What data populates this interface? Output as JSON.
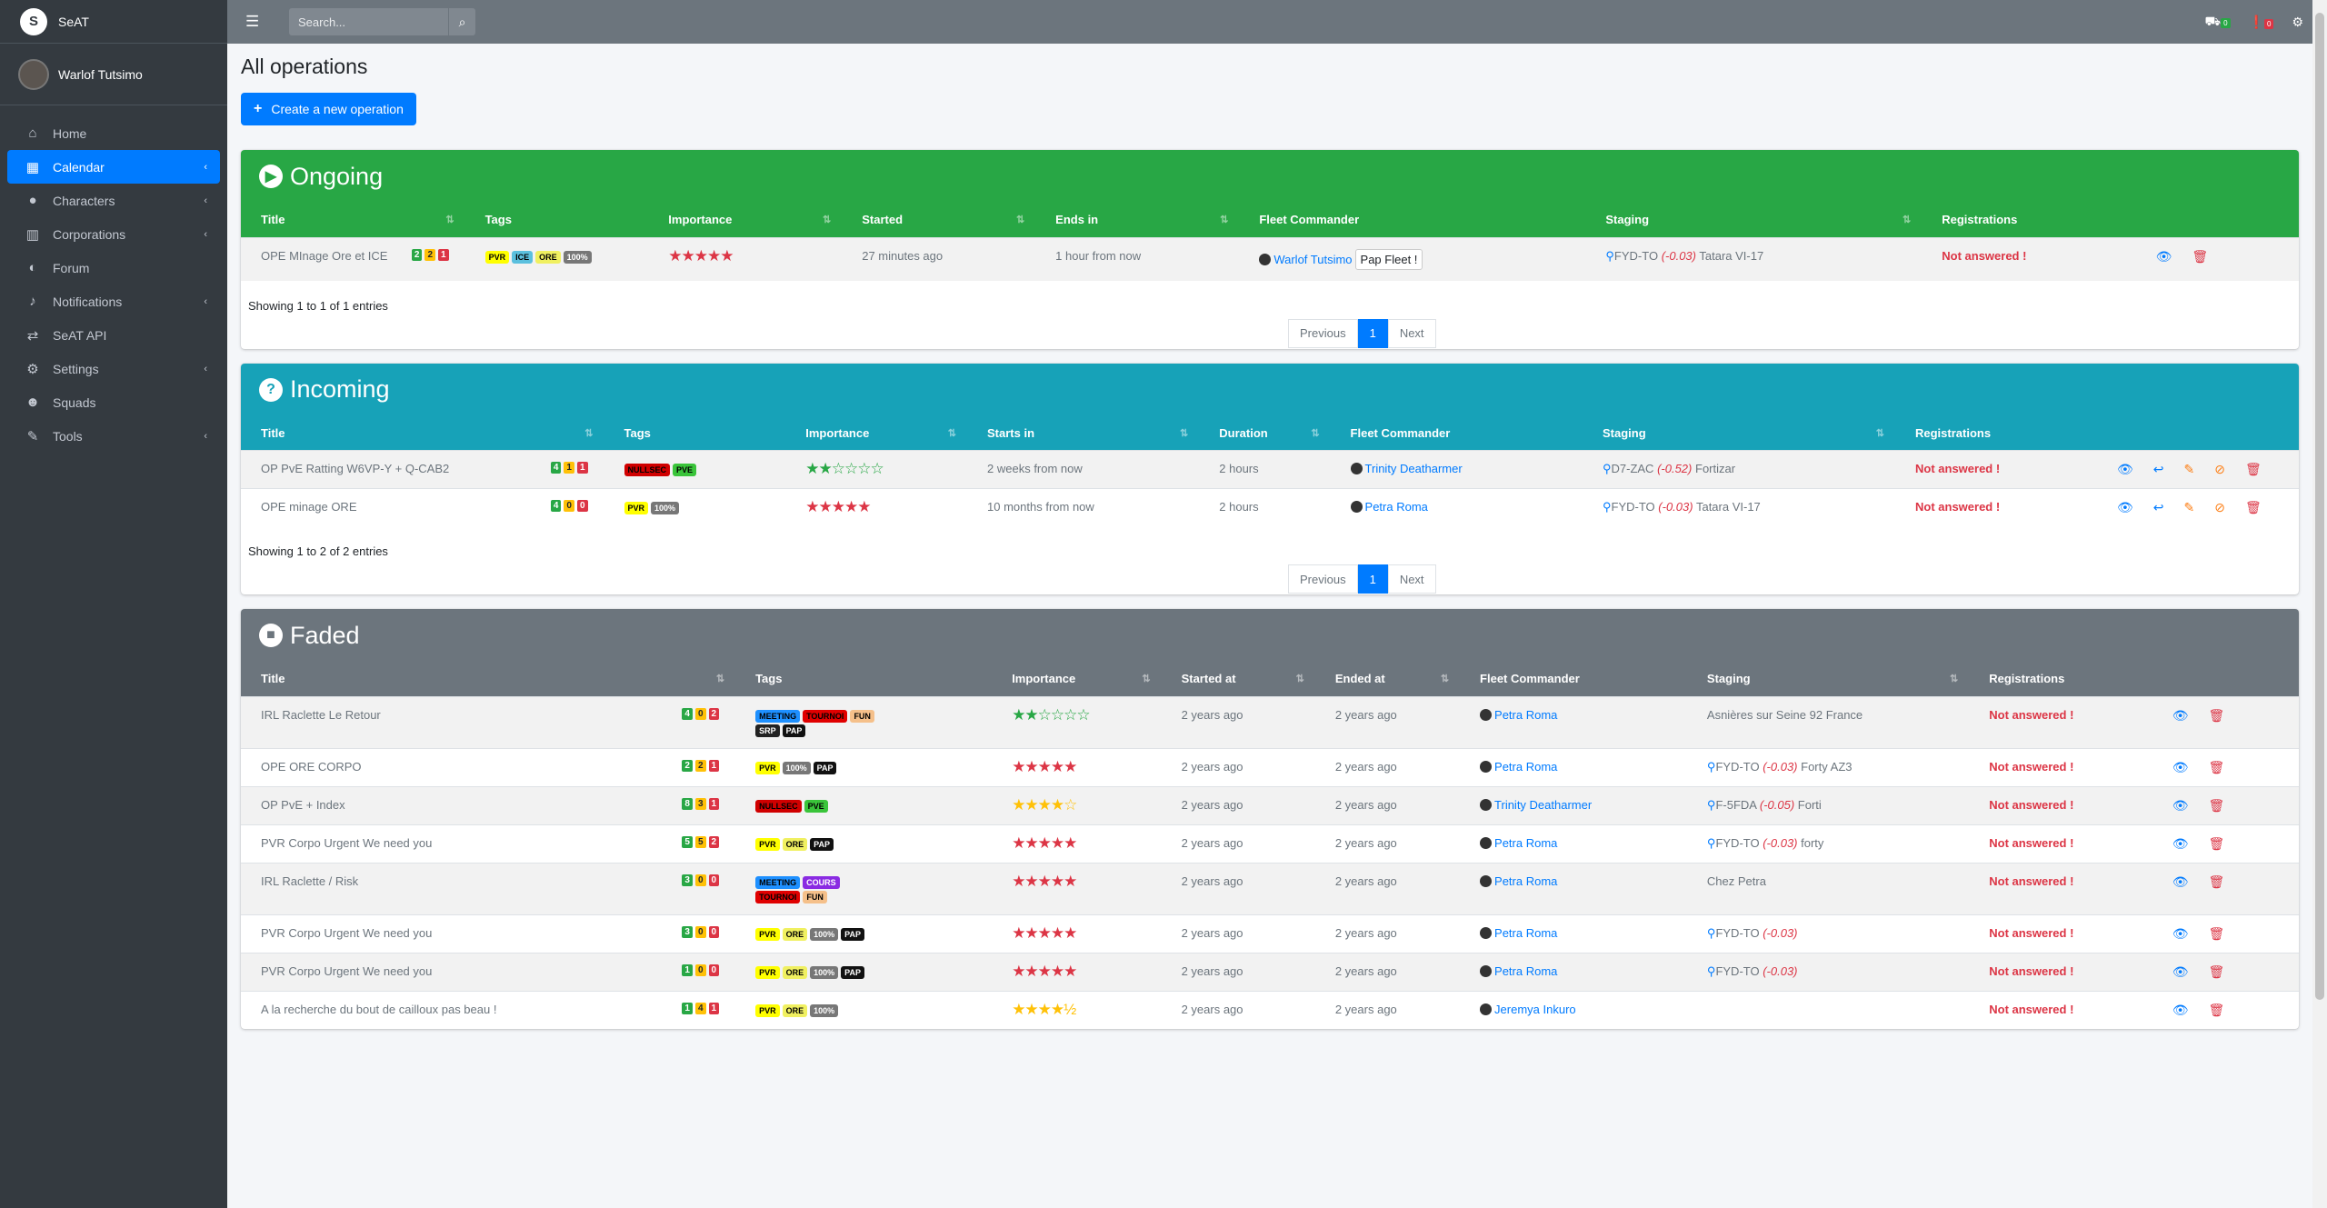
{
  "app": {
    "brand": "SeAT",
    "logo": "S",
    "user": "Warlof Tutsimo"
  },
  "sidebar": {
    "items": [
      {
        "label": "Home",
        "icon": "⌂",
        "chev": ""
      },
      {
        "label": "Calendar",
        "icon": "▦",
        "chev": "‹"
      },
      {
        "label": "Characters",
        "icon": "●",
        "chev": "‹"
      },
      {
        "label": "Corporations",
        "icon": "▥",
        "chev": "‹"
      },
      {
        "label": "Forum",
        "icon": "◐",
        "chev": ""
      },
      {
        "label": "Notifications",
        "icon": "♪",
        "chev": "‹"
      },
      {
        "label": "SeAT API",
        "icon": "⇄",
        "chev": ""
      },
      {
        "label": "Settings",
        "icon": "⚙",
        "chev": "‹"
      },
      {
        "label": "Squads",
        "icon": "☻",
        "chev": ""
      },
      {
        "label": "Tools",
        "icon": "✎",
        "chev": "‹"
      }
    ]
  },
  "topbar": {
    "search_placeholder": "Search...",
    "queue_count": "0",
    "error_count": "0"
  },
  "page": {
    "title": "All operations",
    "create_label": "Create a new operation",
    "showing_1": "Showing 1 to 1 of 1 entries",
    "showing_2": "Showing 1 to 2 of 2 entries",
    "pager": {
      "prev": "Previous",
      "page": "1",
      "next": "Next"
    }
  },
  "ongoing": {
    "title": "Ongoing",
    "headers": [
      "Title",
      "Tags",
      "Importance",
      "Started",
      "Ends in",
      "Fleet Commander",
      "Staging",
      "Registrations"
    ],
    "rows": [
      {
        "title": "OPE MInage Ore et ICE",
        "counts": [
          "2",
          "2",
          "1"
        ],
        "tags": [
          "PVR",
          "ICE",
          "ORE",
          "100%"
        ],
        "stars": "★★★★★",
        "time1": "27 minutes ago",
        "time2": "1 hour from now",
        "fc": "Warlof Tutsimo",
        "pap": "Pap Fleet !",
        "system": "FYD-TO",
        "sec": "(-0.03)",
        "station": "Tatara VI-17",
        "reg": "Not answered !"
      }
    ]
  },
  "incoming": {
    "title": "Incoming",
    "headers": [
      "Title",
      "Tags",
      "Importance",
      "Starts in",
      "Duration",
      "Fleet Commander",
      "Staging",
      "Registrations"
    ],
    "rows": [
      {
        "title": "OP PvE Ratting W6VP-Y + Q-CAB2",
        "counts": [
          "4",
          "1",
          "1"
        ],
        "tags": [
          "NULLSEC",
          "PVE"
        ],
        "stars": "★★☆☆☆☆",
        "time1": "2 weeks from now",
        "time2": "2 hours",
        "fc": "Trinity Deatharmer",
        "system": "D7-ZAC",
        "sec": "(-0.52)",
        "station": "Fortizar",
        "reg": "Not answered !"
      },
      {
        "title": "OPE minage ORE",
        "counts": [
          "4",
          "0",
          "0"
        ],
        "tags": [
          "PVR",
          "100%"
        ],
        "stars": "★★★★★",
        "time1": "10 months from now",
        "time2": "2 hours",
        "fc": "Petra Roma",
        "system": "FYD-TO",
        "sec": "(-0.03)",
        "station": "Tatara VI-17",
        "reg": "Not answered !"
      }
    ]
  },
  "faded": {
    "title": "Faded",
    "headers": [
      "Title",
      "Tags",
      "Importance",
      "Started at",
      "Ended at",
      "Fleet Commander",
      "Staging",
      "Registrations"
    ],
    "rows": [
      {
        "title": "IRL Raclette Le Retour",
        "counts": [
          "4",
          "0",
          "2"
        ],
        "tags": [
          "MEETING",
          "TOURNOI",
          "FUN",
          "SRP",
          "PAP"
        ],
        "stars": "★★☆☆☆☆",
        "time1": "2 years ago",
        "time2": "2 years ago",
        "fc": "Petra Roma",
        "system": "",
        "sec": "",
        "station": "Asnières sur Seine 92 France",
        "reg": "Not answered !"
      },
      {
        "title": "OPE ORE CORPO",
        "counts": [
          "2",
          "2",
          "1"
        ],
        "tags": [
          "PVR",
          "100%",
          "PAP"
        ],
        "stars": "★★★★★",
        "time1": "2 years ago",
        "time2": "2 years ago",
        "fc": "Petra Roma",
        "system": "FYD-TO",
        "sec": "(-0.03)",
        "station": "Forty AZ3",
        "reg": "Not answered !"
      },
      {
        "title": "OP PvE + Index",
        "counts": [
          "8",
          "3",
          "1"
        ],
        "tags": [
          "NULLSEC",
          "PVE"
        ],
        "stars": "★★★★☆",
        "time1": "2 years ago",
        "time2": "2 years ago",
        "fc": "Trinity Deatharmer",
        "system": "F-5FDA",
        "sec": "(-0.05)",
        "station": "Forti",
        "reg": "Not answered !"
      },
      {
        "title": "PVR Corpo Urgent We need you",
        "counts": [
          "5",
          "5",
          "2"
        ],
        "tags": [
          "PVR",
          "ORE",
          "PAP"
        ],
        "stars": "★★★★★",
        "time1": "2 years ago",
        "time2": "2 years ago",
        "fc": "Petra Roma",
        "system": "FYD-TO",
        "sec": "(-0.03)",
        "station": "forty",
        "reg": "Not answered !"
      },
      {
        "title": "IRL Raclette / Risk",
        "counts": [
          "3",
          "0",
          "0"
        ],
        "tags": [
          "MEETING",
          "COURS",
          "TOURNOI",
          "FUN"
        ],
        "stars": "★★★★★",
        "time1": "2 years ago",
        "time2": "2 years ago",
        "fc": "Petra Roma",
        "system": "",
        "sec": "",
        "station": "Chez Petra",
        "reg": "Not answered !"
      },
      {
        "title": "PVR Corpo Urgent We need you",
        "counts": [
          "3",
          "0",
          "0"
        ],
        "tags": [
          "PVR",
          "ORE",
          "100%",
          "PAP"
        ],
        "stars": "★★★★★",
        "time1": "2 years ago",
        "time2": "2 years ago",
        "fc": "Petra Roma",
        "system": "FYD-TO",
        "sec": "(-0.03)",
        "station": "",
        "reg": "Not answered !"
      },
      {
        "title": "PVR Corpo Urgent We need you",
        "counts": [
          "1",
          "0",
          "0"
        ],
        "tags": [
          "PVR",
          "ORE",
          "100%",
          "PAP"
        ],
        "stars": "★★★★★",
        "time1": "2 years ago",
        "time2": "2 years ago",
        "fc": "Petra Roma",
        "system": "FYD-TO",
        "sec": "(-0.03)",
        "station": "",
        "reg": "Not answered !"
      },
      {
        "title": "A la recherche du bout de cailloux pas beau !",
        "counts": [
          "1",
          "4",
          "1"
        ],
        "tags": [
          "PVR",
          "ORE",
          "100%"
        ],
        "stars": "★★★★½",
        "time1": "2 years ago",
        "time2": "2 years ago",
        "fc": "Jeremya Inkuro",
        "system": "",
        "sec": "",
        "station": "",
        "reg": "Not answered !"
      }
    ]
  },
  "colors": {
    "ongoing": "#28a745",
    "incoming": "#17a2b8",
    "faded": "#6c757d",
    "primary": "#007bff",
    "danger": "#dc3545"
  },
  "tag_colors": {
    "PVR": [
      "#ffff00",
      "#000"
    ],
    "ICE": [
      "#5bc0de",
      "#000"
    ],
    "ORE": [
      "#f0f060",
      "#000"
    ],
    "100%": [
      "#777",
      "#fff"
    ],
    "NULLSEC": [
      "#d00000",
      "#000"
    ],
    "PVE": [
      "#3ac43a",
      "#000"
    ],
    "MEETING": [
      "#1e90ff",
      "#000"
    ],
    "TOURNOI": [
      "#e00000",
      "#000"
    ],
    "FUN": [
      "#f5c08a",
      "#000"
    ],
    "SRP": [
      "#222",
      "#fff"
    ],
    "PAP": [
      "#111",
      "#fff"
    ],
    "COURS": [
      "#8a2be2",
      "#fff"
    ]
  },
  "icons": {
    "eye": "view-icon",
    "trash": "delete-icon",
    "reply": "subscribe-icon",
    "pencil": "edit-icon",
    "ban": "cancel-icon"
  }
}
